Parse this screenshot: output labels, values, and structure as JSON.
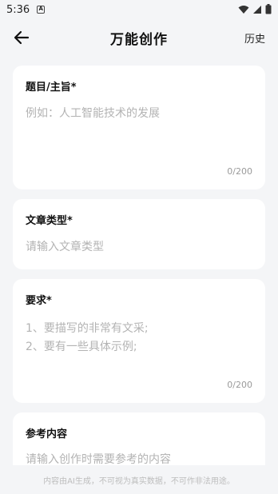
{
  "status_bar": {
    "time": "5:36",
    "notif_letter": "A"
  },
  "header": {
    "title": "万能创作",
    "history_label": "历史"
  },
  "topic_card": {
    "label": "题目/主旨*",
    "placeholder": "例如：人工智能技术的发展",
    "counter": "0/200"
  },
  "type_card": {
    "label": "文章类型*",
    "placeholder": "请输入文章类型"
  },
  "requirements_card": {
    "label": "要求*",
    "placeholder": "1、要描写的非常有文采;\n2、要有一些具体示例;",
    "counter": "0/200"
  },
  "reference_card": {
    "label": "参考内容",
    "placeholder": "请输入创作时需要参考的内容"
  },
  "footer": {
    "disclaimer": "内容由AI生成，不可视为真实数据，不可作非法用途。"
  }
}
